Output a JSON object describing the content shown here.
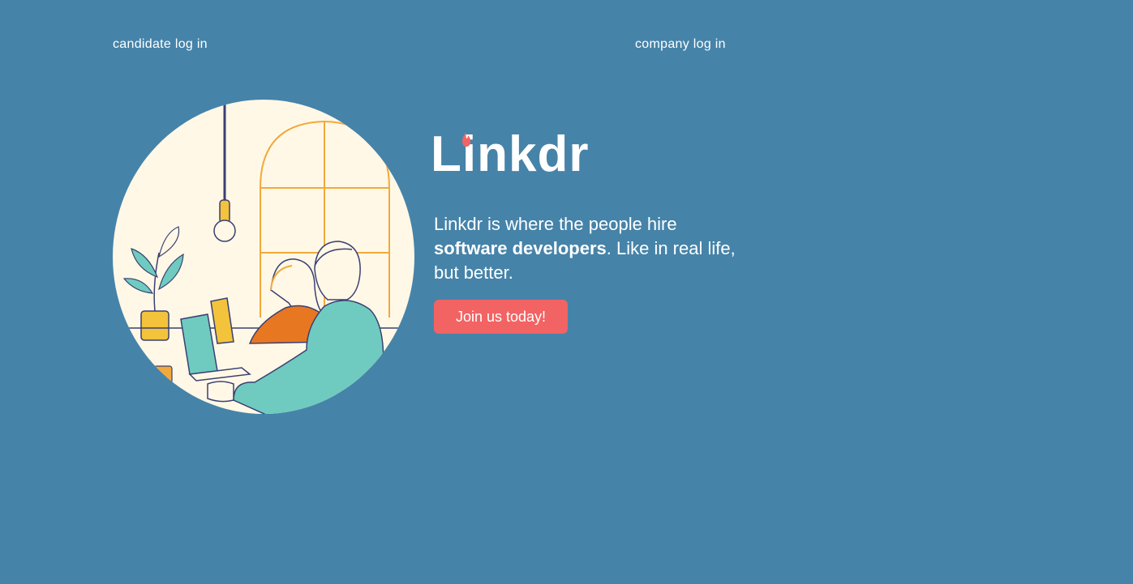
{
  "nav": {
    "candidate_login": "candidate log in",
    "company_login": "company log in"
  },
  "brand": {
    "name": "Linkdr"
  },
  "hero": {
    "tagline_lead": "Linkdr is where the people hire ",
    "tagline_bold": "software developers",
    "tagline_tail": ". Like in real life, but better.",
    "cta_label": "Join us today!"
  },
  "colors": {
    "background": "#4683a9",
    "accent": "#f26363",
    "illustration_bg": "#fff8e6",
    "illustration_orange": "#f2a93b",
    "illustration_teal": "#6fcbbf"
  }
}
